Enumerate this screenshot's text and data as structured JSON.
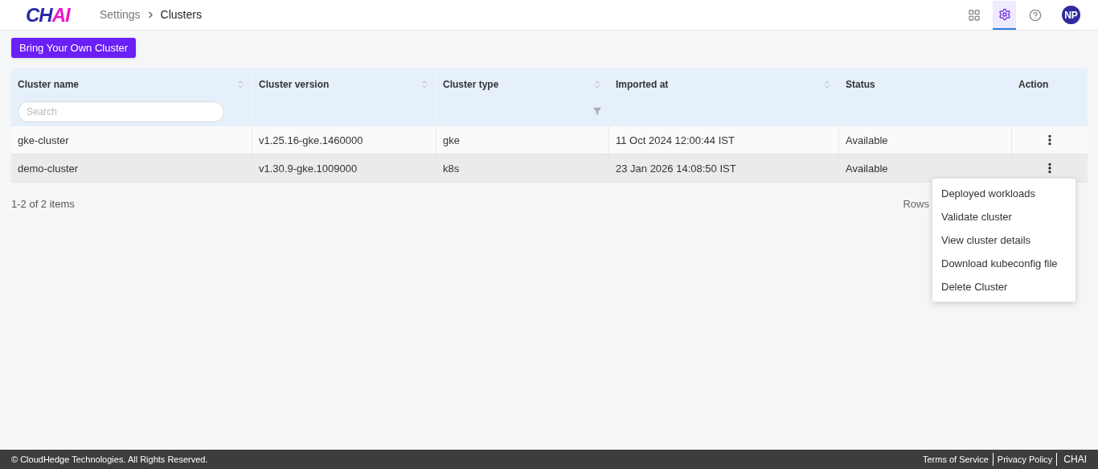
{
  "header": {
    "logo": {
      "first": "CH",
      "second": "AI"
    },
    "breadcrumb": [
      {
        "label": "Settings",
        "current": false
      },
      {
        "label": "Clusters",
        "current": true
      }
    ],
    "nav_icons": [
      {
        "kind": "apps",
        "selected": false
      },
      {
        "kind": "settings",
        "selected": true
      },
      {
        "kind": "help",
        "selected": false
      }
    ],
    "avatar": "NP"
  },
  "primary_button": "Bring Your Own Cluster",
  "table": {
    "columns": [
      {
        "label": "Cluster name",
        "sortable": true,
        "filterable": false,
        "search_placeholder": "Search"
      },
      {
        "label": "Cluster version",
        "sortable": true,
        "filterable": false
      },
      {
        "label": "Cluster type",
        "sortable": true,
        "filterable": true
      },
      {
        "label": "Imported at",
        "sortable": true,
        "filterable": false
      },
      {
        "label": "Status",
        "sortable": false,
        "filterable": false
      },
      {
        "label": "Action",
        "sortable": false,
        "filterable": false
      }
    ],
    "rows": [
      {
        "cells": [
          "gke-cluster",
          "v1.25.16-gke.1460000",
          "gke",
          "11 Oct 2024 12:00:44 IST",
          "Available"
        ],
        "highlighted": false
      },
      {
        "cells": [
          "demo-cluster",
          "v1.30.9-gke.1009000",
          "k8s",
          "23 Jan 2026 14:08:50 IST",
          "Available"
        ],
        "highlighted": true
      }
    ]
  },
  "pagination": {
    "summary": "1-2 of 2 items",
    "rows_label": "Rows"
  },
  "action_menu": {
    "items": [
      "Deployed workloads",
      "Validate cluster",
      "View cluster details",
      "Download kubeconfig file",
      "Delete Cluster"
    ]
  },
  "footer": {
    "copyright": "© CloudHedge Technologies. All Rights Reserved.",
    "links": [
      "Terms of Service",
      "Privacy Policy",
      "CHAI"
    ]
  }
}
